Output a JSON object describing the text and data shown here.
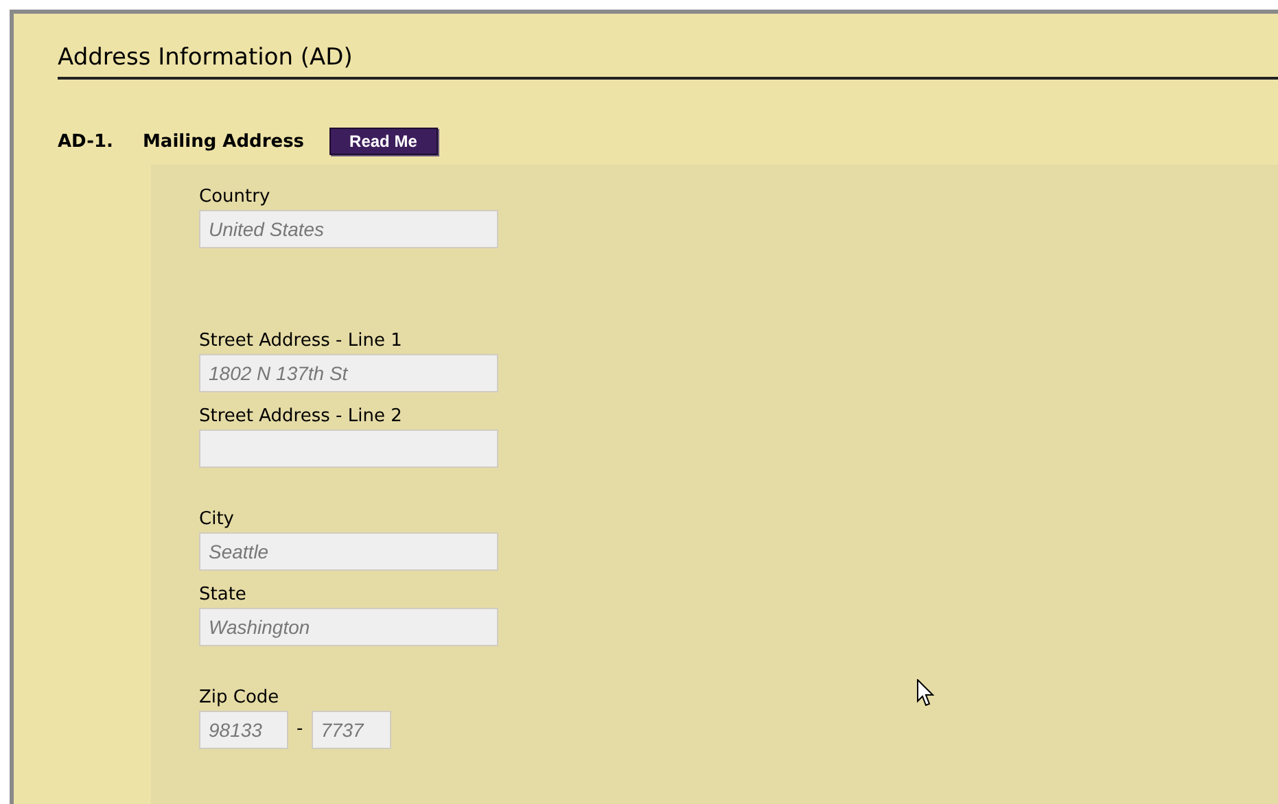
{
  "section": {
    "title": "Address Information (AD)"
  },
  "question": {
    "number": "AD-1.",
    "title": "Mailing Address",
    "button": "Read Me"
  },
  "groups": [
    [
      {
        "kind": "single",
        "label": "Country",
        "values": [
          "United States"
        ]
      }
    ],
    [
      {
        "kind": "single",
        "label": "Street Address - Line 1",
        "values": [
          "1802 N 137th St"
        ]
      },
      {
        "kind": "single",
        "label": "Street Address - Line 2"
      }
    ],
    [
      {
        "kind": "single",
        "label": "City",
        "values": [
          "Seattle"
        ]
      },
      {
        "kind": "single",
        "label": "State",
        "values": [
          "Washington"
        ]
      }
    ],
    [
      {
        "kind": "split",
        "label": "Zip Code",
        "values": [
          "98133",
          "7737"
        ],
        "separator": "-"
      }
    ]
  ]
}
